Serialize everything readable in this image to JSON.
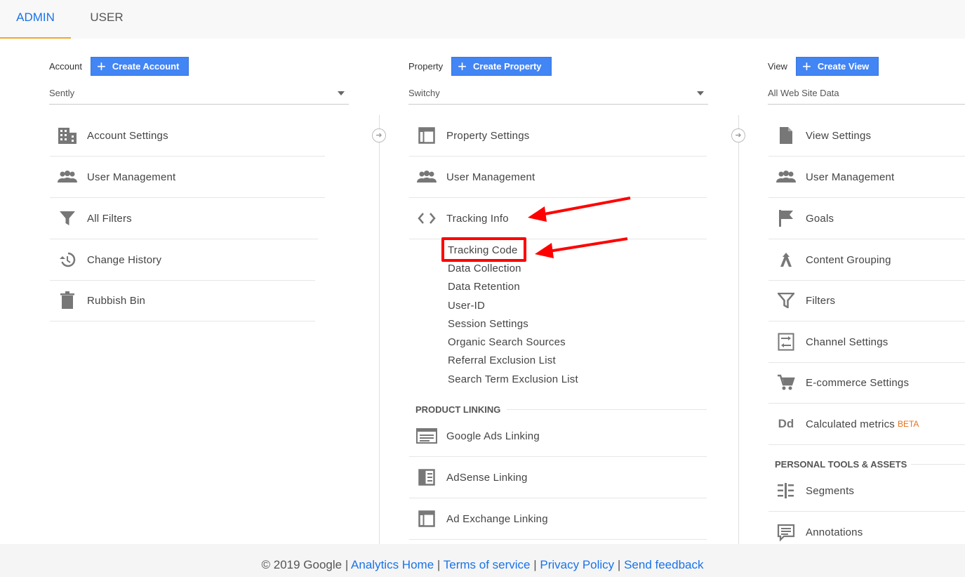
{
  "tabs": {
    "admin": "ADMIN",
    "user": "USER"
  },
  "account": {
    "label": "Account",
    "create_button": "Create Account",
    "selected": "Sently",
    "items": [
      {
        "label": "Account Settings",
        "icon": "building-icon"
      },
      {
        "label": "User Management",
        "icon": "people-icon"
      },
      {
        "label": "All Filters",
        "icon": "filter-icon"
      },
      {
        "label": "Change History",
        "icon": "history-icon"
      },
      {
        "label": "Rubbish Bin",
        "icon": "trash-icon"
      }
    ]
  },
  "property": {
    "label": "Property",
    "create_button": "Create Property",
    "selected": "Switchy",
    "items": [
      {
        "label": "Property Settings",
        "icon": "window-icon"
      },
      {
        "label": "User Management",
        "icon": "people-icon"
      },
      {
        "label": "Tracking Info",
        "icon": "code-icon"
      }
    ],
    "tracking_sub_items": [
      "Tracking Code",
      "Data Collection",
      "Data Retention",
      "User-ID",
      "Session Settings",
      "Organic Search Sources",
      "Referral Exclusion List",
      "Search Term Exclusion List"
    ],
    "product_linking_heading": "PRODUCT LINKING",
    "linking_items": [
      {
        "label": "Google Ads Linking",
        "icon": "ads-icon"
      },
      {
        "label": "AdSense Linking",
        "icon": "adsense-icon"
      },
      {
        "label": "Ad Exchange Linking",
        "icon": "window-icon"
      }
    ]
  },
  "view": {
    "label": "View",
    "create_button": "Create View",
    "selected": "All Web Site Data",
    "items": [
      {
        "label": "View Settings",
        "icon": "document-icon"
      },
      {
        "label": "User Management",
        "icon": "people-icon"
      },
      {
        "label": "Goals",
        "icon": "flag-icon"
      },
      {
        "label": "Content Grouping",
        "icon": "grouping-icon"
      },
      {
        "label": "Filters",
        "icon": "filter-icon"
      },
      {
        "label": "Channel Settings",
        "icon": "channel-icon"
      },
      {
        "label": "E-commerce Settings",
        "icon": "cart-icon"
      },
      {
        "label": "Calculated metrics",
        "icon": "dd-icon",
        "badge": "BETA"
      }
    ],
    "personal_heading": "PERSONAL TOOLS & ASSETS",
    "personal_items": [
      {
        "label": "Segments",
        "icon": "segments-icon"
      },
      {
        "label": "Annotations",
        "icon": "annotation-icon"
      }
    ]
  },
  "footer": {
    "copyright": "© 2019 Google",
    "links": [
      "Analytics Home",
      "Terms of service",
      "Privacy Policy",
      "Send feedback"
    ]
  },
  "colors": {
    "accent": "#1a73e8",
    "button": "#4285f4",
    "highlight": "#ff0000",
    "tab_underline": "#f5a623",
    "beta": "#e8711a"
  }
}
